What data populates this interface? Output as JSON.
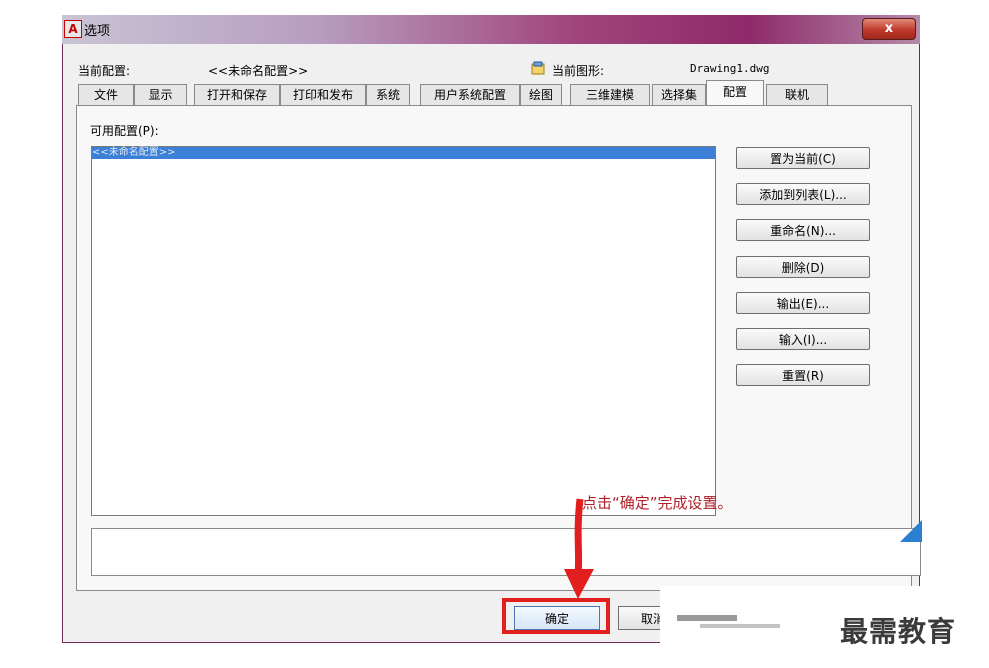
{
  "window": {
    "title": "选项",
    "app_icon_letter": "A",
    "close_symbol": "x"
  },
  "header": {
    "current_profile_label": "当前配置:",
    "current_profile_value": "<<未命名配置>>",
    "current_drawing_label": "当前图形:",
    "current_drawing_value": "Drawing1.dwg"
  },
  "tabs": [
    "文件",
    "显示",
    "打开和保存",
    "打印和发布",
    "系统",
    "用户系统配置",
    "绘图",
    "三维建模",
    "选择集",
    "配置",
    "联机"
  ],
  "active_tab": "配置",
  "profiles": {
    "label": "可用配置(P):",
    "items": [
      "<<未命名配置>>"
    ]
  },
  "actions": {
    "set_current": "置为当前(C)",
    "add_to_list": "添加到列表(L)...",
    "rename": "重命名(N)...",
    "delete": "删除(D)",
    "export": "输出(E)...",
    "import": "输入(I)...",
    "reset": "重置(R)"
  },
  "footer": {
    "ok": "确定",
    "cancel": "取消"
  },
  "annotation": "点击“确定”完成设置。",
  "watermark": "最需教育",
  "colors": {
    "arrow": "#e21f1f",
    "annotation_text": "#b0202a",
    "selection": "#3b7fd6"
  }
}
